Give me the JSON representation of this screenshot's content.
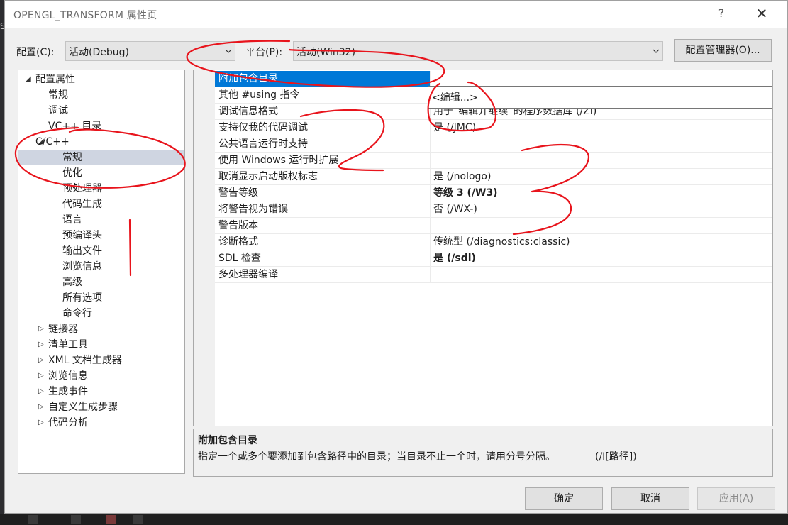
{
  "window": {
    "title": "OPENGL_TRANSFORM 属性页",
    "help_label": "?",
    "close_label": "✕"
  },
  "toolbar": {
    "config_label": "配置(C):",
    "config_value": "活动(Debug)",
    "platform_label": "平台(P):",
    "platform_value": "活动(Win32)",
    "manager_button": "配置管理器(O)..."
  },
  "tree": {
    "items": [
      {
        "label": "配置属性",
        "toggle": "◢"
      },
      {
        "label": "常规"
      },
      {
        "label": "调试"
      },
      {
        "label": "VC++ 目录"
      },
      {
        "label": "C/C++",
        "toggle": "◢"
      },
      {
        "label": "常规",
        "selected": true
      },
      {
        "label": "优化"
      },
      {
        "label": "预处理器"
      },
      {
        "label": "代码生成"
      },
      {
        "label": "语言"
      },
      {
        "label": "预编译头"
      },
      {
        "label": "输出文件"
      },
      {
        "label": "浏览信息"
      },
      {
        "label": "高级"
      },
      {
        "label": "所有选项"
      },
      {
        "label": "命令行"
      },
      {
        "label": "链接器",
        "toggle": "▷"
      },
      {
        "label": "清单工具",
        "toggle": "▷"
      },
      {
        "label": "XML 文档生成器",
        "toggle": "▷"
      },
      {
        "label": "浏览信息",
        "toggle": "▷"
      },
      {
        "label": "生成事件",
        "toggle": "▷"
      },
      {
        "label": "自定义生成步骤",
        "toggle": "▷"
      },
      {
        "label": "代码分析",
        "toggle": "▷"
      }
    ]
  },
  "properties": [
    {
      "name": "附加包含目录",
      "value": "",
      "selected": true
    },
    {
      "name": "其他 #using 指令",
      "value": ""
    },
    {
      "name": "调试信息格式",
      "value": "用于“编辑并继续”的程序数据库 (/ZI)"
    },
    {
      "name": "支持仅我的代码调试",
      "value": "是 (/JMC)"
    },
    {
      "name": "公共语言运行时支持",
      "value": ""
    },
    {
      "name": "使用 Windows 运行时扩展",
      "value": ""
    },
    {
      "name": "取消显示启动版权标志",
      "value": "是 (/nologo)"
    },
    {
      "name": "警告等级",
      "value": "等级 3 (/W3)",
      "bold": true
    },
    {
      "name": "将警告视为错误",
      "value": "否 (/WX-)"
    },
    {
      "name": "警告版本",
      "value": ""
    },
    {
      "name": "诊断格式",
      "value": "传统型 (/diagnostics:classic)"
    },
    {
      "name": "SDL 检查",
      "value": "是 (/sdl)",
      "bold": true
    },
    {
      "name": "多处理器编译",
      "value": ""
    }
  ],
  "popup": {
    "item": "<编辑...>"
  },
  "description": {
    "title": "附加包含目录",
    "text": "指定一个或多个要添加到包含路径中的目录；当目录不止一个时，请用分号分隔。",
    "flag": "(/I[路径])"
  },
  "buttons": {
    "ok": "确定",
    "cancel": "取消",
    "apply": "应用(A)"
  },
  "annotations": {
    "color": "#e8141c",
    "mark_2": "2",
    "mark_3": "3"
  },
  "ide_fragment": "SP"
}
